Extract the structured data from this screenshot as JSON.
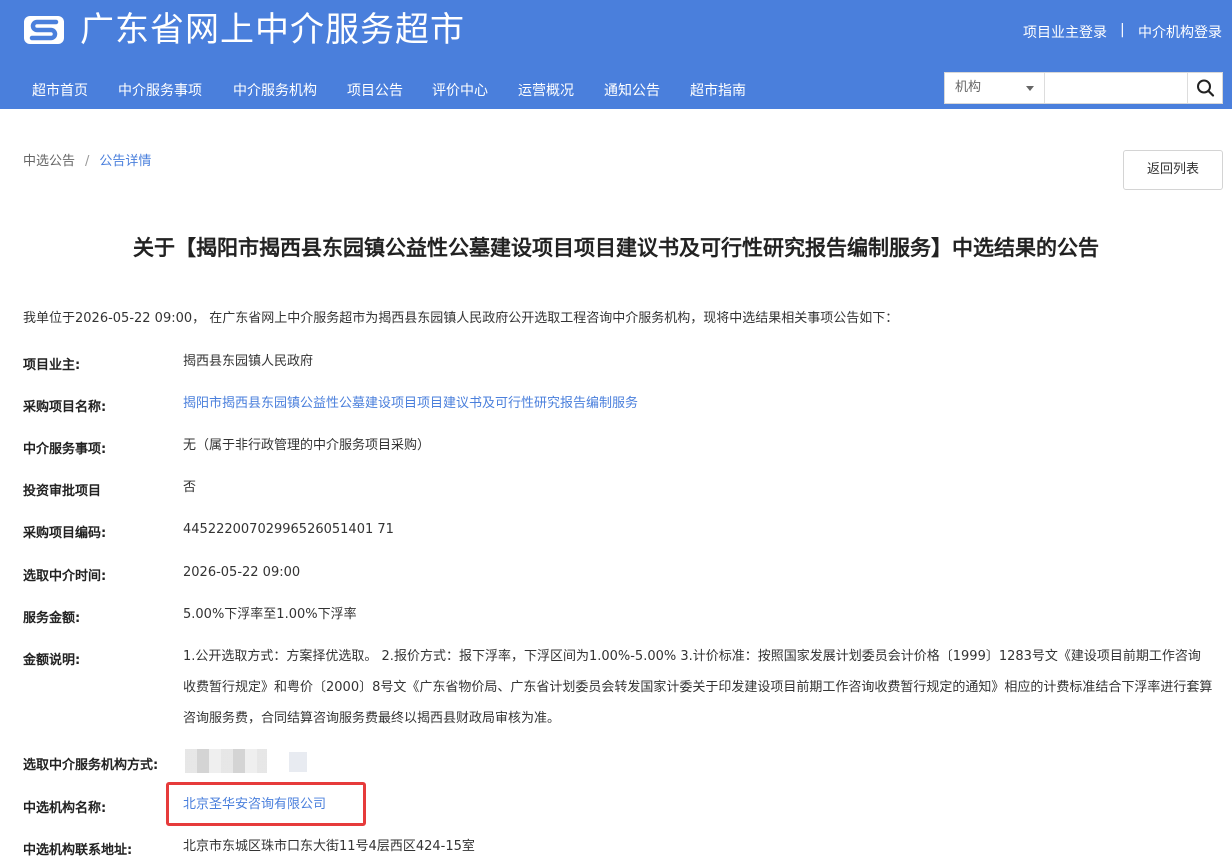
{
  "header": {
    "site_title": "广东省网上中介服务超市",
    "logo_icon": "s-logo-icon",
    "owner_login": "项目业主登录",
    "separator": "|",
    "agency_login": "中介机构登录",
    "brand_color": "#4a7fdc"
  },
  "nav": {
    "items": [
      "超市首页",
      "中介服务事项",
      "中介服务机构",
      "项目公告",
      "评价中心",
      "运营概况",
      "通知公告",
      "超市指南"
    ]
  },
  "search": {
    "category": "机构",
    "value": "",
    "button_icon": "search-icon"
  },
  "breadcrumb": {
    "parent": "中选公告",
    "separator": "/",
    "current": "公告详情"
  },
  "back_button": "返回列表",
  "announcement": {
    "title": "关于【揭阳市揭西县东园镇公益性公墓建设项目项目建议书及可行性研究报告编制服务】中选结果的公告",
    "intro": "我单位于2026-05-22 09:00， 在广东省网上中介服务超市为揭西县东园镇人民政府公开选取工程咨询中介服务机构，现将中选结果相关事项公告如下：",
    "fields": [
      {
        "label": "项目业主:",
        "value": "揭西县东园镇人民政府"
      },
      {
        "label": "采购项目名称:",
        "value": "揭阳市揭西县东园镇公益性公墓建设项目项目建议书及可行性研究报告编制服务"
      },
      {
        "label": "中介服务事项:",
        "value": "无（属于非行政管理的中介服务项目采购）"
      },
      {
        "label": "投资审批项目",
        "value": "否"
      },
      {
        "label": "采购项目编码:",
        "value": "44522200702996526051401 71"
      },
      {
        "label": "选取中介时间:",
        "value": "2026-05-22 09:00"
      },
      {
        "label": "服务金额:",
        "value": "5.00%下浮率至1.00%下浮率"
      },
      {
        "label": "金额说明:",
        "value": "1.公开选取方式：方案择优选取。 2.报价方式：报下浮率，下浮区间为1.00%-5.00% 3.计价标准：按照国家发展计划委员会计价格〔1999〕1283号文《建设项目前期工作咨询收费暂行规定》和粤价〔2000〕8号文《广东省物价局、广东省计划委员会转发国家计委关于印发建设项目前期工作咨询收费暂行规定的通知》相应的计费标准结合下浮率进行套算咨询服务费，合同结算咨询服务费最终以揭西县财政局审核为准。"
      },
      {
        "label": "选取中介服务机构方式:",
        "value": ""
      },
      {
        "label": "中选机构名称:",
        "value": "北京圣华安咨询有限公司"
      },
      {
        "label": "中选机构联系地址:",
        "value": "北京市东城区珠市口东大街11号4层西区424-15室"
      }
    ]
  }
}
